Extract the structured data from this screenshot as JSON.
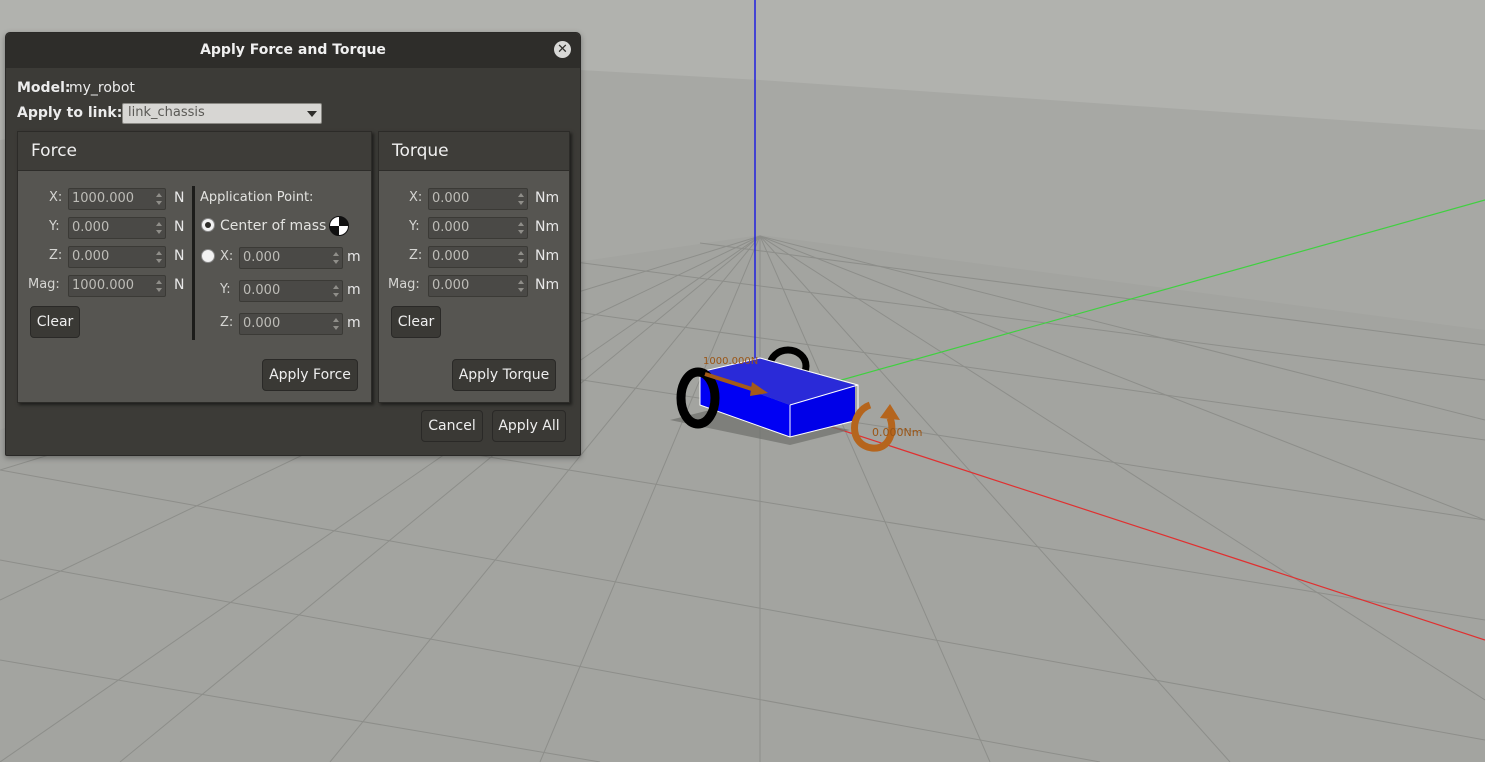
{
  "dialog": {
    "title": "Apply Force and Torque",
    "close_glyph": "✕",
    "model_label": "Model:",
    "model_value": "my_robot",
    "link_label": "Apply to link:",
    "link_value": "link_chassis",
    "cancel_label": "Cancel",
    "apply_all_label": "Apply All"
  },
  "force": {
    "title": "Force",
    "x_label": "X:",
    "x_value": "1000.000",
    "x_unit": "N",
    "y_label": "Y:",
    "y_value": "0.000",
    "y_unit": "N",
    "z_label": "Z:",
    "z_value": "0.000",
    "z_unit": "N",
    "mag_label": "Mag:",
    "mag_value": "1000.000",
    "mag_unit": "N",
    "clear_label": "Clear",
    "apply_label": "Apply Force",
    "app_point_label": "Application Point:",
    "com_label": "Center of mass",
    "px_label": "X:",
    "px_value": "0.000",
    "px_unit": "m",
    "py_label": "Y:",
    "py_value": "0.000",
    "py_unit": "m",
    "pz_label": "Z:",
    "pz_value": "0.000",
    "pz_unit": "m"
  },
  "torque": {
    "title": "Torque",
    "x_label": "X:",
    "x_value": "0.000",
    "x_unit": "Nm",
    "y_label": "Y:",
    "y_value": "0.000",
    "y_unit": "Nm",
    "z_label": "Z:",
    "z_value": "0.000",
    "z_unit": "Nm",
    "mag_label": "Mag:",
    "mag_value": "0.000",
    "mag_unit": "Nm",
    "clear_label": "Clear",
    "apply_label": "Apply Torque"
  },
  "scene": {
    "force_visual_label": "1000.000N",
    "torque_visual_label": "0.000Nm",
    "colors": {
      "sky": "#b0b1ad",
      "ground": "#a4a5a1",
      "grid": "#8a8b87",
      "x_axis": "#e03030",
      "y_axis": "#40d040",
      "z_axis": "#2020e0",
      "chassis": "#0a0af0",
      "force_arrow": "#a45a18",
      "torque_arrow": "#b5651d"
    }
  }
}
